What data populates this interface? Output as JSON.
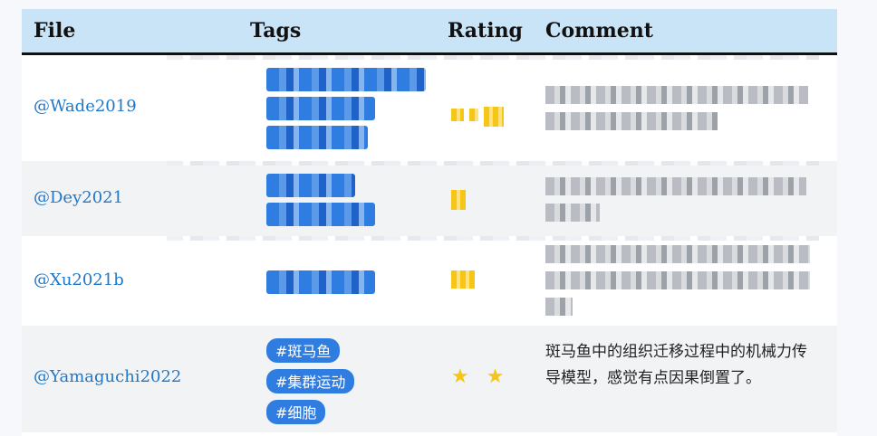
{
  "table": {
    "headers": {
      "file": "File",
      "tags": "Tags",
      "rating": "Rating",
      "comment": "Comment"
    },
    "rows": [
      {
        "file": "@Wade2019",
        "tags": [],
        "rating_stars": 3,
        "comment": "",
        "obscured": true
      },
      {
        "file": "@Dey2021",
        "tags": [],
        "rating_stars": 1,
        "comment": "",
        "obscured": true
      },
      {
        "file": "@Xu2021b",
        "tags": [],
        "rating_stars": 1,
        "comment": "",
        "obscured": true
      },
      {
        "file": "@Yamaguchi2022",
        "tags": [
          "#斑马鱼",
          "#集群运动",
          "#细胞"
        ],
        "rating": "★ ★",
        "rating_stars": 2,
        "comment": "斑马鱼中的组织迁移过程中的机械力传导模型，感觉有点因果倒置了。",
        "obscured": false
      }
    ]
  },
  "colors": {
    "header_bg": "#c9e3f7",
    "link": "#1f77c9",
    "tag_bg": "#2f7de1",
    "star": "#f5c518",
    "alt_row": "#f2f3f5"
  }
}
